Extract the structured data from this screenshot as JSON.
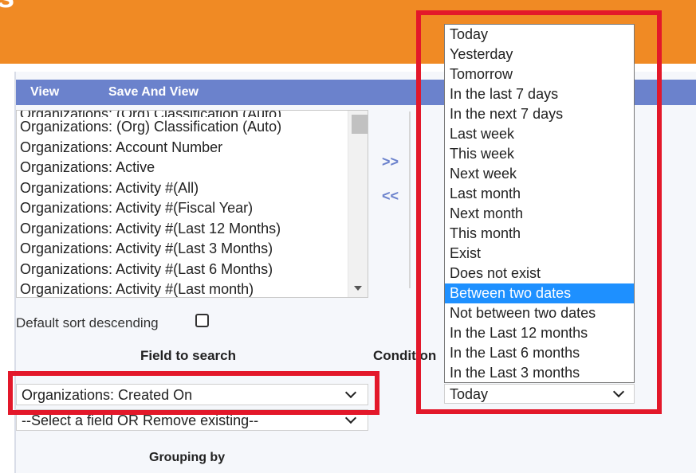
{
  "header": {
    "title": "s"
  },
  "toolbar": {
    "view_label": "View",
    "save_view_label": "Save And View"
  },
  "field_list": {
    "partial_top": "Organizations: (Org) Classification (Auto)",
    "items": [
      "Organizations: (Org) Classification (Auto)",
      "Organizations: Account Number",
      "Organizations: Active",
      "Organizations: Activity #(All)",
      "Organizations: Activity #(Fiscal Year)",
      "Organizations: Activity #(Last 12 Months)",
      "Organizations: Activity #(Last 3 Months)",
      "Organizations: Activity #(Last 6 Months)",
      "Organizations: Activity #(Last month)"
    ]
  },
  "move": {
    "add_label": ">>",
    "remove_label": "<<"
  },
  "sort": {
    "label": "Default sort descending",
    "checked": false
  },
  "labels": {
    "field_to_search": "Field to search",
    "condition": "Condition",
    "grouping_by": "Grouping by"
  },
  "field_select": {
    "value": "Organizations: Created On"
  },
  "field_select2": {
    "value": "--Select a field OR Remove existing--"
  },
  "condition_select": {
    "value": "Today",
    "options": [
      "Today",
      "Yesterday",
      "Tomorrow",
      "In the last 7 days",
      "In the next 7 days",
      "Last week",
      "This week",
      "Next week",
      "Last month",
      "Next month",
      "This month",
      "Exist",
      "Does not exist",
      "Between two dates",
      "Not between two dates",
      "In the Last 12 months",
      "In the Last 6 months",
      "In the Last 3 months"
    ],
    "highlighted": "Between two dates"
  },
  "colors": {
    "header": "#f08a24",
    "nav": "#6b82cc",
    "highlight": "#1e90ff",
    "annotation": "#e3182a"
  }
}
